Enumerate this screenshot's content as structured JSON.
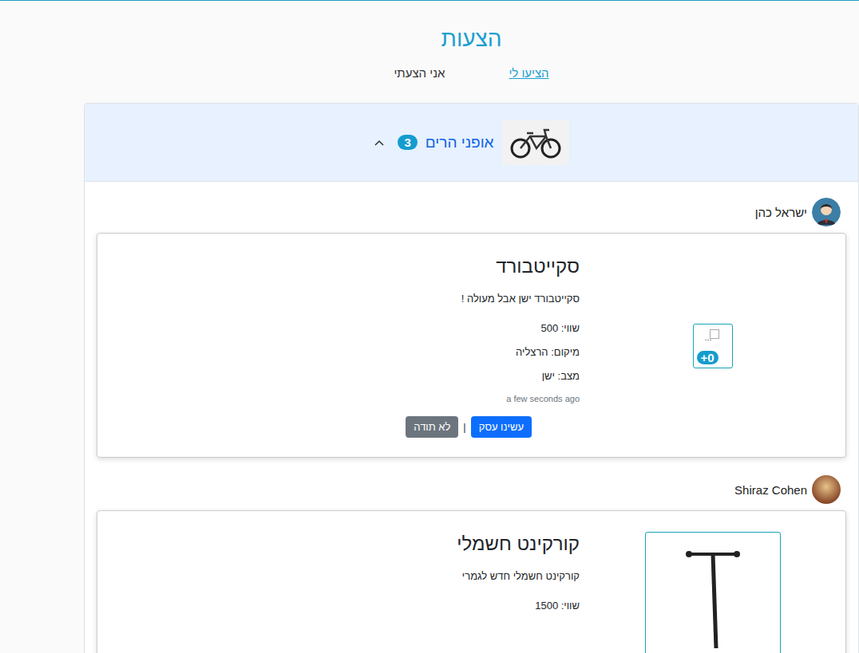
{
  "page": {
    "title": "הצעות"
  },
  "tabs": [
    {
      "label": "הציעו לי",
      "selected": true
    },
    {
      "label": "אני הצעתי",
      "selected": false
    }
  ],
  "items": [
    {
      "title": "אופני הרים",
      "count": "3",
      "expanded": true,
      "offers": [
        {
          "user": "ישראל כהן",
          "kind": "broken-image",
          "image_alt": "...",
          "image_count": "+0",
          "title": "סקייטבורד",
          "description": "סקייטבורד ישן אבל מעולה !",
          "details": [
            "שווי: 500",
            "מיקום: הרצליה",
            "מצב: ישן"
          ],
          "time": "a few seconds ago",
          "actions": [
            {
              "label": "עשינו עסק",
              "kind": "primary"
            },
            {
              "label": "|",
              "kind": "separator"
            },
            {
              "label": "לא תודה",
              "kind": "secondary"
            }
          ]
        },
        {
          "user": "Shiraz Cohen",
          "kind": "photo",
          "title": "קורקינט חשמלי",
          "description": "קורקינט חשמלי חדש לגמרי",
          "details": [
            "שווי: 1500"
          ]
        }
      ]
    }
  ]
}
